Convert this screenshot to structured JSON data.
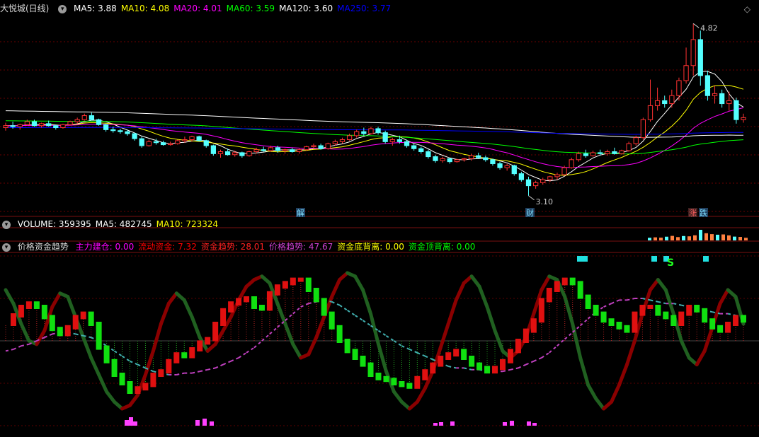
{
  "title": "大悦城(日线)",
  "main_header": [
    {
      "label": "MA5: 3.88",
      "color": "#ffffff"
    },
    {
      "label": "MA10: 4.08",
      "color": "#ffff00"
    },
    {
      "label": "MA20: 4.01",
      "color": "#ff00ff"
    },
    {
      "label": "MA60: 3.59",
      "color": "#00ff00"
    },
    {
      "label": "MA120: 3.60",
      "color": "#ffffff"
    },
    {
      "label": "MA250: 3.77",
      "color": "#0000ff"
    }
  ],
  "volume_header": [
    {
      "label": "VOLUME: 359395",
      "color": "#ffffff"
    },
    {
      "label": "MA5: 482745",
      "color": "#ffffff"
    },
    {
      "label": "MA10: 723324",
      "color": "#ffff00"
    }
  ],
  "indicator_header": {
    "name": "价格资金趋势",
    "items": [
      {
        "label": "主力建仓: 0.00",
        "color": "#ff00ff"
      },
      {
        "label": "流动资金: 7.32",
        "color": "#ff0000"
      },
      {
        "label": "资金趋势: 28.01",
        "color": "#ff2020"
      },
      {
        "label": "价格趋势: 47.67",
        "color": "#d040d0"
      },
      {
        "label": "资金底背离: 0.00",
        "color": "#ffff00"
      },
      {
        "label": "资金顶背离: 0.00",
        "color": "#00ff00"
      }
    ]
  },
  "markers": {
    "jie": "解",
    "cai": "财",
    "zhang": "涨",
    "die": "跌",
    "s": "S"
  },
  "icons": {
    "circle": "circle-toggle-icon",
    "diamond": "diamond-icon"
  },
  "chart_data": {
    "type": "candlestick",
    "price": {
      "ylim": [
        2.95,
        4.9
      ],
      "high_label": "4.82",
      "low_label": "3.10",
      "candles": [
        [
          3.78,
          3.83,
          3.75,
          3.8
        ],
        [
          3.8,
          3.84,
          3.77,
          3.79
        ],
        [
          3.79,
          3.82,
          3.76,
          3.81
        ],
        [
          3.81,
          3.86,
          3.8,
          3.84
        ],
        [
          3.84,
          3.86,
          3.79,
          3.8
        ],
        [
          3.8,
          3.83,
          3.78,
          3.82
        ],
        [
          3.82,
          3.85,
          3.79,
          3.8
        ],
        [
          3.8,
          3.81,
          3.76,
          3.78
        ],
        [
          3.78,
          3.82,
          3.77,
          3.81
        ],
        [
          3.81,
          3.85,
          3.8,
          3.84
        ],
        [
          3.84,
          3.88,
          3.82,
          3.86
        ],
        [
          3.86,
          3.92,
          3.85,
          3.9
        ],
        [
          3.9,
          3.93,
          3.85,
          3.86
        ],
        [
          3.86,
          3.87,
          3.8,
          3.81
        ],
        [
          3.81,
          3.82,
          3.74,
          3.76
        ],
        [
          3.76,
          3.79,
          3.73,
          3.75
        ],
        [
          3.75,
          3.77,
          3.72,
          3.74
        ],
        [
          3.74,
          3.76,
          3.7,
          3.72
        ],
        [
          3.72,
          3.73,
          3.65,
          3.67
        ],
        [
          3.67,
          3.69,
          3.58,
          3.6
        ],
        [
          3.6,
          3.66,
          3.59,
          3.64
        ],
        [
          3.64,
          3.67,
          3.61,
          3.63
        ],
        [
          3.63,
          3.65,
          3.6,
          3.61
        ],
        [
          3.61,
          3.64,
          3.6,
          3.62
        ],
        [
          3.62,
          3.66,
          3.61,
          3.65
        ],
        [
          3.65,
          3.69,
          3.63,
          3.66
        ],
        [
          3.66,
          3.7,
          3.64,
          3.69
        ],
        [
          3.69,
          3.7,
          3.64,
          3.65
        ],
        [
          3.65,
          3.66,
          3.58,
          3.6
        ],
        [
          3.6,
          3.61,
          3.5,
          3.52
        ],
        [
          3.52,
          3.56,
          3.48,
          3.54
        ],
        [
          3.54,
          3.57,
          3.5,
          3.51
        ],
        [
          3.51,
          3.55,
          3.49,
          3.53
        ],
        [
          3.53,
          3.54,
          3.48,
          3.5
        ],
        [
          3.5,
          3.55,
          3.49,
          3.54
        ],
        [
          3.54,
          3.58,
          3.52,
          3.56
        ],
        [
          3.56,
          3.59,
          3.54,
          3.55
        ],
        [
          3.55,
          3.6,
          3.54,
          3.58
        ],
        [
          3.58,
          3.6,
          3.53,
          3.55
        ],
        [
          3.55,
          3.57,
          3.52,
          3.56
        ],
        [
          3.56,
          3.58,
          3.53,
          3.54
        ],
        [
          3.54,
          3.57,
          3.52,
          3.56
        ],
        [
          3.56,
          3.6,
          3.55,
          3.59
        ],
        [
          3.59,
          3.62,
          3.57,
          3.6
        ],
        [
          3.6,
          3.62,
          3.56,
          3.57
        ],
        [
          3.57,
          3.63,
          3.56,
          3.62
        ],
        [
          3.62,
          3.66,
          3.6,
          3.64
        ],
        [
          3.64,
          3.68,
          3.62,
          3.66
        ],
        [
          3.66,
          3.72,
          3.65,
          3.7
        ],
        [
          3.7,
          3.76,
          3.68,
          3.74
        ],
        [
          3.74,
          3.78,
          3.7,
          3.72
        ],
        [
          3.72,
          3.79,
          3.71,
          3.77
        ],
        [
          3.77,
          3.79,
          3.71,
          3.73
        ],
        [
          3.73,
          3.75,
          3.62,
          3.64
        ],
        [
          3.64,
          3.68,
          3.6,
          3.66
        ],
        [
          3.66,
          3.7,
          3.62,
          3.64
        ],
        [
          3.64,
          3.66,
          3.58,
          3.6
        ],
        [
          3.6,
          3.62,
          3.55,
          3.57
        ],
        [
          3.57,
          3.59,
          3.52,
          3.54
        ],
        [
          3.54,
          3.56,
          3.47,
          3.49
        ],
        [
          3.49,
          3.51,
          3.43,
          3.45
        ],
        [
          3.45,
          3.49,
          3.43,
          3.47
        ],
        [
          3.47,
          3.48,
          3.42,
          3.44
        ],
        [
          3.44,
          3.47,
          3.43,
          3.46
        ],
        [
          3.46,
          3.48,
          3.44,
          3.47
        ],
        [
          3.47,
          3.52,
          3.45,
          3.5
        ],
        [
          3.5,
          3.53,
          3.47,
          3.48
        ],
        [
          3.48,
          3.5,
          3.44,
          3.46
        ],
        [
          3.46,
          3.47,
          3.4,
          3.42
        ],
        [
          3.42,
          3.44,
          3.36,
          3.38
        ],
        [
          3.38,
          3.42,
          3.35,
          3.4
        ],
        [
          3.4,
          3.41,
          3.3,
          3.32
        ],
        [
          3.32,
          3.34,
          3.24,
          3.26
        ],
        [
          3.26,
          3.29,
          3.1,
          3.2
        ],
        [
          3.2,
          3.25,
          3.17,
          3.23
        ],
        [
          3.23,
          3.28,
          3.21,
          3.26
        ],
        [
          3.26,
          3.3,
          3.24,
          3.29
        ],
        [
          3.29,
          3.33,
          3.26,
          3.31
        ],
        [
          3.31,
          3.4,
          3.3,
          3.38
        ],
        [
          3.38,
          3.48,
          3.37,
          3.46
        ],
        [
          3.46,
          3.54,
          3.44,
          3.52
        ],
        [
          3.52,
          3.56,
          3.48,
          3.5
        ],
        [
          3.5,
          3.55,
          3.49,
          3.53
        ],
        [
          3.53,
          3.56,
          3.5,
          3.52
        ],
        [
          3.52,
          3.56,
          3.5,
          3.54
        ],
        [
          3.54,
          3.58,
          3.51,
          3.52
        ],
        [
          3.52,
          3.56,
          3.51,
          3.55
        ],
        [
          3.55,
          3.64,
          3.54,
          3.62
        ],
        [
          3.62,
          3.7,
          3.6,
          3.68
        ],
        [
          3.68,
          3.88,
          3.66,
          3.86
        ],
        [
          3.86,
          4.26,
          3.84,
          4.0
        ],
        [
          4.0,
          4.18,
          3.95,
          4.05
        ],
        [
          4.05,
          4.1,
          3.98,
          4.02
        ],
        [
          4.02,
          4.16,
          3.98,
          4.1
        ],
        [
          4.1,
          4.28,
          4.05,
          4.25
        ],
        [
          4.25,
          4.58,
          4.22,
          4.4
        ],
        [
          4.4,
          4.82,
          4.3,
          4.66
        ],
        [
          4.66,
          4.75,
          4.2,
          4.3
        ],
        [
          4.3,
          4.35,
          4.05,
          4.1
        ],
        [
          4.1,
          4.2,
          4.02,
          4.12
        ],
        [
          4.12,
          4.16,
          3.98,
          4.02
        ],
        [
          4.02,
          4.14,
          3.95,
          4.05
        ],
        [
          4.05,
          4.08,
          3.82,
          3.86
        ],
        [
          3.86,
          3.92,
          3.83,
          3.88
        ]
      ],
      "ma": [
        {
          "name": "MA5",
          "color": "#ffffff"
        },
        {
          "name": "MA10",
          "color": "#ffff00"
        },
        {
          "name": "MA20",
          "color": "#ff00ff"
        },
        {
          "name": "MA60",
          "color": "#00ff00"
        },
        {
          "name": "MA120",
          "color": "#ffffff"
        },
        {
          "name": "MA250",
          "color": "#0000ff"
        }
      ]
    },
    "volume": {
      "values": [
        359395,
        420000,
        380000,
        510000,
        620000,
        455000,
        600000,
        560000,
        700000,
        1450000,
        980000,
        860000,
        780000,
        820000,
        690000,
        520000,
        480000,
        359395
      ]
    },
    "indicator": {
      "ylim": [
        0,
        100
      ],
      "zero_level": 50,
      "fund_trend": [
        60,
        65,
        70,
        72,
        70,
        64,
        57,
        54,
        58,
        64,
        66,
        60,
        46,
        38,
        30,
        25,
        20,
        22,
        24,
        30,
        32,
        38,
        42,
        41,
        45,
        49,
        51,
        60,
        68,
        72,
        74,
        75,
        70,
        69,
        78,
        82,
        84,
        86,
        86,
        80,
        74,
        66,
        58,
        50,
        44,
        40,
        36,
        30,
        28,
        27,
        25,
        24,
        23,
        28,
        32,
        36,
        40,
        42,
        44,
        40,
        36,
        34,
        32,
        34,
        38,
        44,
        50,
        56,
        62,
        74,
        80,
        84,
        86,
        84,
        76,
        70,
        66,
        62,
        60,
        58,
        56,
        66,
        70,
        70,
        66,
        64,
        60,
        66,
        70,
        68,
        62,
        58,
        56,
        60,
        64,
        62
      ],
      "price_trend": [
        44,
        45,
        47,
        48,
        50,
        52,
        54,
        55,
        55,
        54,
        53,
        52,
        50,
        47,
        44,
        41,
        38,
        36,
        34,
        32,
        31,
        30,
        30,
        31,
        31,
        32,
        33,
        34,
        36,
        38,
        40,
        43,
        46,
        50,
        54,
        58,
        62,
        66,
        70,
        72,
        73,
        74,
        73,
        71,
        68,
        65,
        62,
        59,
        56,
        53,
        50,
        47,
        45,
        43,
        41,
        39,
        37,
        35,
        34,
        34,
        33,
        33,
        32,
        32,
        32,
        33,
        34,
        36,
        38,
        40,
        43,
        47,
        51,
        55,
        59,
        63,
        67,
        70,
        72,
        74,
        74,
        75,
        75,
        74,
        73,
        72,
        72,
        71,
        70,
        69,
        68,
        67,
        66,
        66,
        65,
        64
      ],
      "money_flow": [
        80,
        72,
        60,
        50,
        48,
        56,
        70,
        78,
        76,
        64,
        52,
        40,
        30,
        20,
        14,
        10,
        12,
        18,
        30,
        44,
        60,
        72,
        78,
        74,
        64,
        52,
        44,
        48,
        56,
        64,
        74,
        82,
        86,
        88,
        84,
        72,
        60,
        48,
        40,
        42,
        52,
        64,
        76,
        86,
        90,
        88,
        80,
        66,
        48,
        32,
        20,
        14,
        10,
        14,
        22,
        32,
        46,
        60,
        74,
        84,
        88,
        82,
        70,
        56,
        44,
        40,
        44,
        52,
        66,
        80,
        88,
        86,
        76,
        60,
        40,
        24,
        16,
        10,
        14,
        24,
        36,
        50,
        66,
        80,
        86,
        80,
        66,
        50,
        40,
        36,
        44,
        58,
        72,
        80,
        76,
        60
      ]
    }
  }
}
